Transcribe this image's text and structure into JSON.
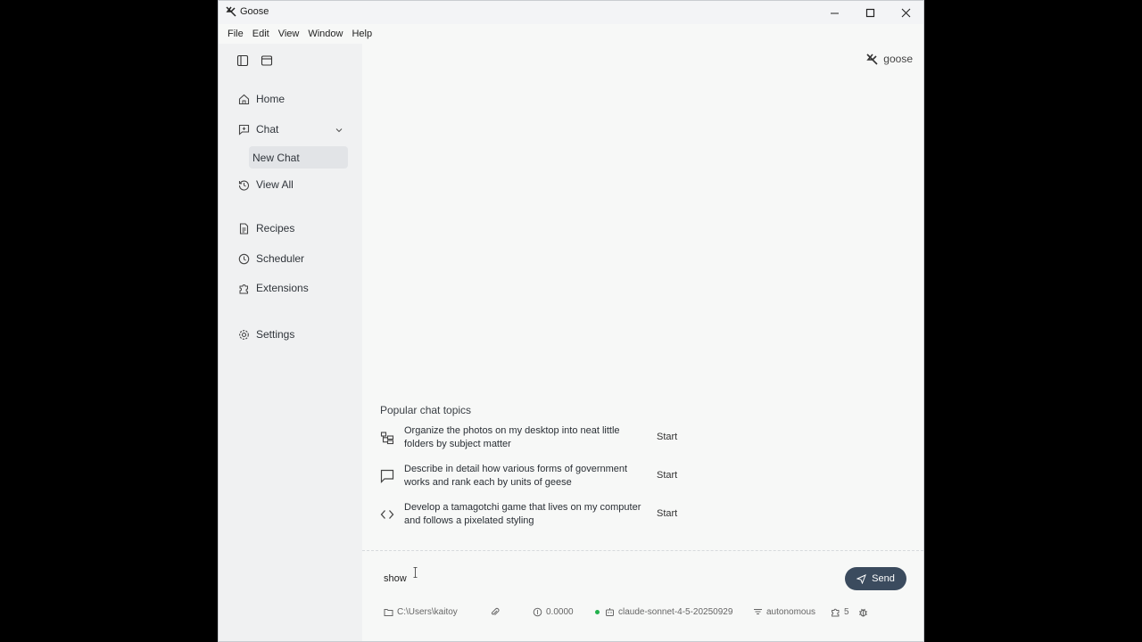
{
  "window": {
    "title": "Goose"
  },
  "menubar": {
    "items": [
      "File",
      "Edit",
      "View",
      "Window",
      "Help"
    ]
  },
  "sidebar": {
    "home": "Home",
    "chat": "Chat",
    "new_chat": "New Chat",
    "view_all": "View All",
    "recipes": "Recipes",
    "scheduler": "Scheduler",
    "extensions": "Extensions",
    "settings": "Settings"
  },
  "brand": {
    "label": "goose"
  },
  "topics": {
    "title": "Popular chat topics",
    "items": [
      {
        "icon": "folder-tree-icon",
        "text": "Organize the photos on my desktop into neat little folders by subject matter",
        "action": "Start"
      },
      {
        "icon": "message-square-icon",
        "text": "Describe in detail how various forms of government works and rank each by units of geese",
        "action": "Start"
      },
      {
        "icon": "code-icon",
        "text": "Develop a tamagotchi game that lives on my computer and follows a pixelated styling",
        "action": "Start"
      }
    ]
  },
  "input": {
    "value": "show"
  },
  "send": {
    "label": "Send"
  },
  "footer": {
    "path": "C:\\Users\\kaitoy",
    "cost": "0.0000",
    "model": "claude-sonnet-4-5-20250929",
    "mode": "autonomous",
    "extensions_count": "5"
  },
  "colors": {
    "send_bg": "#3b4b5e",
    "status_dot": "#22b14c"
  }
}
